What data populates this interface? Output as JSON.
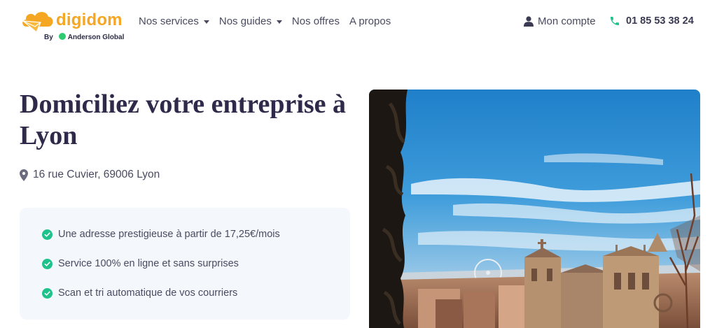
{
  "header": {
    "logo": {
      "brand": "digidom",
      "by": "By",
      "partner": "Anderson Global"
    },
    "nav": [
      {
        "label": "Nos services",
        "dropdown": true
      },
      {
        "label": "Nos guides",
        "dropdown": true
      },
      {
        "label": "Nos offres",
        "dropdown": false
      },
      {
        "label": "A propos",
        "dropdown": false
      }
    ],
    "account_label": "Mon compte",
    "phone": "01 85 53 38 24"
  },
  "hero": {
    "title_line1": "Domiciliez votre entreprise à",
    "title_line2": "Lyon",
    "address": "16 rue Cuvier, 69006 Lyon",
    "features": [
      "Une adresse prestigieuse à partir de 17,25€/mois",
      "Service 100% en ligne et sans surprises",
      "Scan et tri automatique de vos courriers"
    ]
  },
  "colors": {
    "brand_orange": "#f5a623",
    "accent_green": "#1ec28b",
    "text_dark": "#2f2a4a",
    "card_bg": "#f4f8fc"
  },
  "icons": {
    "account": "user-icon",
    "phone": "phone-icon",
    "address": "map-pin-icon",
    "feature": "check-circle-icon"
  }
}
